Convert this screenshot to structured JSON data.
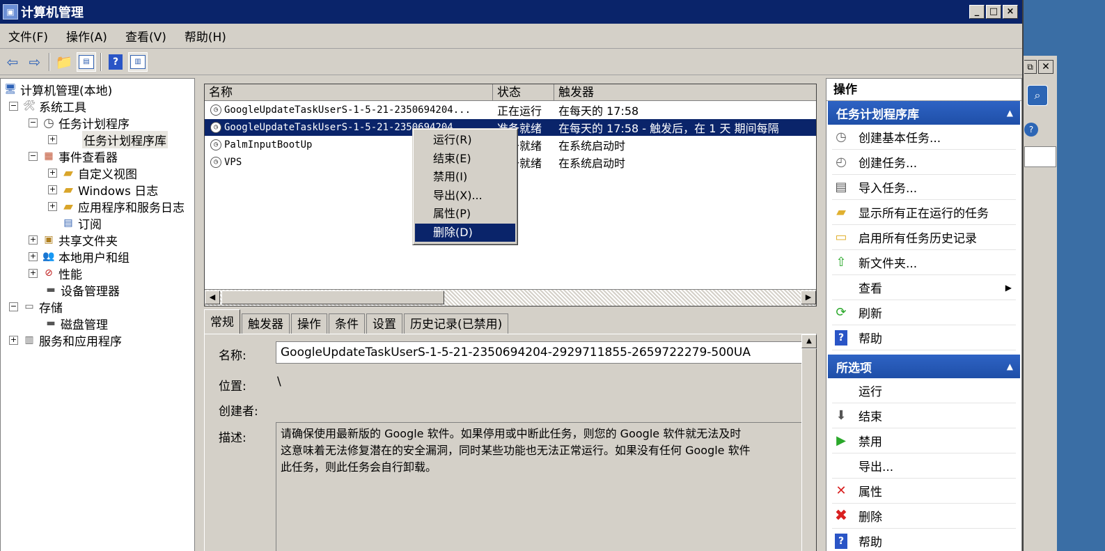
{
  "window": {
    "title": "计算机管理",
    "controls": [
      "_",
      "□",
      "×"
    ]
  },
  "menubar": [
    "文件(F)",
    "操作(A)",
    "查看(V)",
    "帮助(H)"
  ],
  "tree": [
    {
      "label": "计算机管理(本地)",
      "expander": "",
      "icon": "computer-icon"
    },
    {
      "label": "系统工具",
      "expander": "⊟",
      "icon": "tools-icon"
    },
    {
      "label": "任务计划程序",
      "expander": "⊟",
      "icon": "clock-icon"
    },
    {
      "label": "任务计划程序库",
      "expander": "⊞",
      "icon": ""
    },
    {
      "label": "事件查看器",
      "expander": "⊟",
      "icon": "event-viewer-icon"
    },
    {
      "label": "自定义视图",
      "expander": "⊞",
      "icon": "folder-icon"
    },
    {
      "label": "Windows 日志",
      "expander": "⊞",
      "icon": "folder-icon"
    },
    {
      "label": "应用程序和服务日志",
      "expander": "⊞",
      "icon": "folder-icon"
    },
    {
      "label": "订阅",
      "expander": "",
      "icon": "subscription-icon"
    },
    {
      "label": "共享文件夹",
      "expander": "⊞",
      "icon": "shared-folder-icon"
    },
    {
      "label": "本地用户和组",
      "expander": "⊞",
      "icon": "users-icon"
    },
    {
      "label": "性能",
      "expander": "⊞",
      "icon": "performance-icon"
    },
    {
      "label": "设备管理器",
      "expander": "",
      "icon": "device-manager-icon"
    },
    {
      "label": "存储",
      "expander": "⊟",
      "icon": "storage-icon"
    },
    {
      "label": "磁盘管理",
      "expander": "",
      "icon": "disk-icon"
    },
    {
      "label": "服务和应用程序",
      "expander": "⊞",
      "icon": "services-icon"
    }
  ],
  "tasklist": {
    "columns": [
      "名称",
      "状态",
      "触发器"
    ],
    "rows": [
      {
        "name": "GoogleUpdateTaskUserS-1-5-21-2350694204...",
        "status": "正在运行",
        "trigger": "在每天的 17:58"
      },
      {
        "name": "GoogleUpdateTaskUserS-1-5-21-2350694204",
        "status": "准备就绪",
        "trigger": "在每天的 17:58 - 触发后，在 1 天 期间每隔"
      },
      {
        "name": "PalmInputBootUp",
        "status": "准备就绪",
        "trigger": "在系统启动时"
      },
      {
        "name": "VPS",
        "status": "准备就绪",
        "trigger": "在系统启动时"
      }
    ]
  },
  "context_menu": [
    "运行(R)",
    "结束(E)",
    "禁用(I)",
    "导出(X)...",
    "属性(P)",
    "删除(D)"
  ],
  "tabs": [
    "常规",
    "触发器",
    "操作",
    "条件",
    "设置",
    "历史记录(已禁用)"
  ],
  "general": {
    "name_label": "名称:",
    "name_value": "GoogleUpdateTaskUserS-1-5-21-2350694204-2929711855-2659722279-500UA",
    "location_label": "位置:",
    "location_value": "\\",
    "author_label": "创建者:",
    "desc_label": "描述:",
    "desc_lines": [
      "请确保使用最新版的 Google 软件。如果停用或中断此任务，则您的 Google 软件就无法及时",
      "这意味着无法修复潜在的安全漏洞，同时某些功能也无法正常运行。如果没有任何 Google 软件",
      "此任务，则此任务会自行卸载。"
    ]
  },
  "actions": {
    "header": "操作",
    "group1": {
      "title": "任务计划程序库",
      "items": [
        {
          "label": "创建基本任务...",
          "icon": "clock-icon"
        },
        {
          "label": "创建任务...",
          "icon": "task-icon"
        },
        {
          "label": "导入任务...",
          "icon": "import-icon"
        },
        {
          "label": "显示所有正在运行的任务",
          "icon": "running-tasks-icon"
        },
        {
          "label": "启用所有任务历史记录",
          "icon": "history-icon"
        },
        {
          "label": "新文件夹...",
          "icon": "new-folder-icon"
        },
        {
          "label": "查看",
          "icon": "",
          "submenu": "▶"
        },
        {
          "label": "刷新",
          "icon": "refresh-icon"
        },
        {
          "label": "帮助",
          "icon": "help-icon"
        }
      ]
    },
    "group2": {
      "title": "所选项",
      "items": [
        {
          "label": "运行",
          "icon": ""
        },
        {
          "label": "结束",
          "icon": "end-icon"
        },
        {
          "label": "禁用",
          "icon": "disable-icon"
        },
        {
          "label": "导出...",
          "icon": ""
        },
        {
          "label": "属性",
          "icon": "properties-icon"
        },
        {
          "label": "删除",
          "icon": "delete-icon"
        },
        {
          "label": "帮助",
          "icon": "help-icon"
        }
      ]
    }
  }
}
